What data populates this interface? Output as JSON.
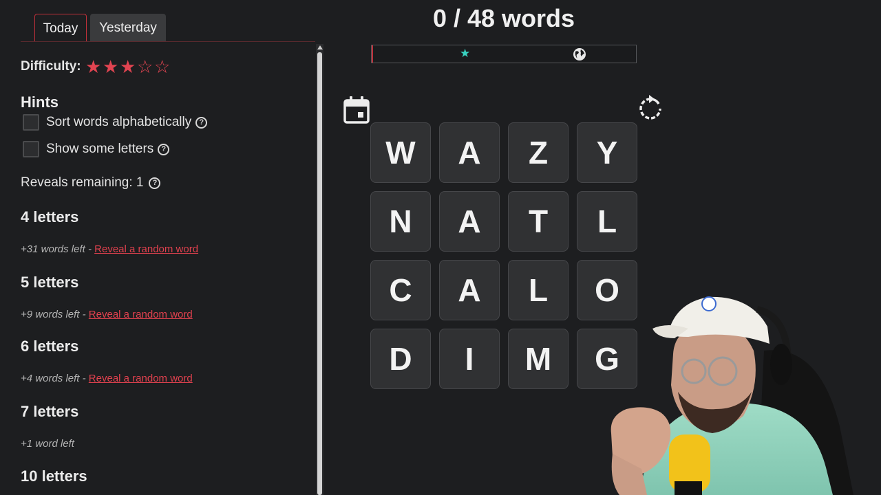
{
  "tabs": [
    {
      "label": "Today",
      "active": true
    },
    {
      "label": "Yesterday",
      "active": false
    }
  ],
  "sidebar": {
    "difficulty_label": "Difficulty:",
    "difficulty_rating": 3,
    "difficulty_max": 5,
    "hints_title": "Hints",
    "hint_options": [
      {
        "label": "Sort words alphabetically",
        "checked": false
      },
      {
        "label": "Show some letters",
        "checked": false
      }
    ],
    "reveals_remaining": "Reveals remaining: 1",
    "groups": [
      {
        "title": "4 letters",
        "sub": "+31 words left - ",
        "link": "Reveal a random word"
      },
      {
        "title": "5 letters",
        "sub": "+9 words left - ",
        "link": "Reveal a random word"
      },
      {
        "title": "6 letters",
        "sub": "+4 words left - ",
        "link": "Reveal a random word"
      },
      {
        "title": "7 letters",
        "sub": "+1 word left",
        "link": ""
      },
      {
        "title": "10 letters",
        "sub": "",
        "link": ""
      }
    ]
  },
  "main": {
    "score": "0 / 48 words",
    "progress_fraction": 0.0,
    "accent_color": "#c0303a",
    "star_color": "#39d2c0",
    "tiles": [
      "W",
      "A",
      "Z",
      "Y",
      "N",
      "A",
      "T",
      "L",
      "C",
      "A",
      "L",
      "O",
      "D",
      "I",
      "M",
      "G"
    ]
  }
}
